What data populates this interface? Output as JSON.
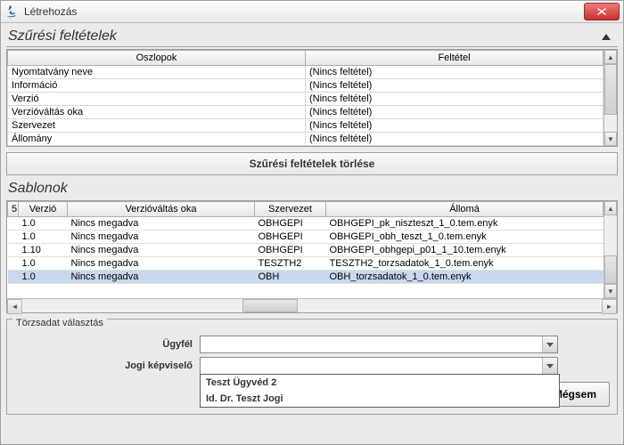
{
  "window": {
    "title": "Létrehozás"
  },
  "filter_section": {
    "title": "Szűrési feltételek",
    "col_columns": "Oszlopok",
    "col_condition": "Feltétel",
    "no_condition": "(Nincs feltétel)",
    "rows": [
      "Nyomtatvány neve",
      "Információ",
      "Verzió",
      "Verzióváltás oka",
      "Szervezet",
      "Állomány"
    ],
    "clear_button": "Szűrési feltételek törlése"
  },
  "templates_section": {
    "title": "Sablonok",
    "headers": {
      "first": "5",
      "verzio": "Verzió",
      "valtas": "Verzióváltás oka",
      "szervezet": "Szervezet",
      "allomany": "Állomá"
    },
    "rows": [
      {
        "verzio": "1.0",
        "valtas": "Nincs megadva",
        "szervezet": "OBHGEPI",
        "allomany": "OBHGEPI_pk_niszteszt_1_0.tem.enyk"
      },
      {
        "verzio": "1.0",
        "valtas": "Nincs megadva",
        "szervezet": "OBHGEPI",
        "allomany": "OBHGEPI_obh_teszt_1_0.tem.enyk"
      },
      {
        "verzio": "1.10",
        "valtas": "Nincs megadva",
        "szervezet": "OBHGEPI",
        "allomany": "OBHGEPI_obhgepi_p01_1_10.tem.enyk"
      },
      {
        "verzio": "1.0",
        "valtas": "Nincs megadva",
        "szervezet": "TESZTH2",
        "allomany": "TESZTH2_torzsadatok_1_0.tem.enyk"
      },
      {
        "verzio": "1.0",
        "valtas": "Nincs megadva",
        "szervezet": "OBH",
        "allomany": "OBH_torzsadatok_1_0.tem.enyk",
        "selected": true
      }
    ]
  },
  "torzsadat": {
    "group_title": "Törzsadat választás",
    "ugyfel_label": "Ügyfél",
    "jogi_label": "Jogi képviselő",
    "jogi_options": [
      "Teszt Ügyvéd 2",
      "Id. Dr. Teszt Jogi"
    ]
  },
  "buttons": {
    "megsem": "Mégsem"
  }
}
